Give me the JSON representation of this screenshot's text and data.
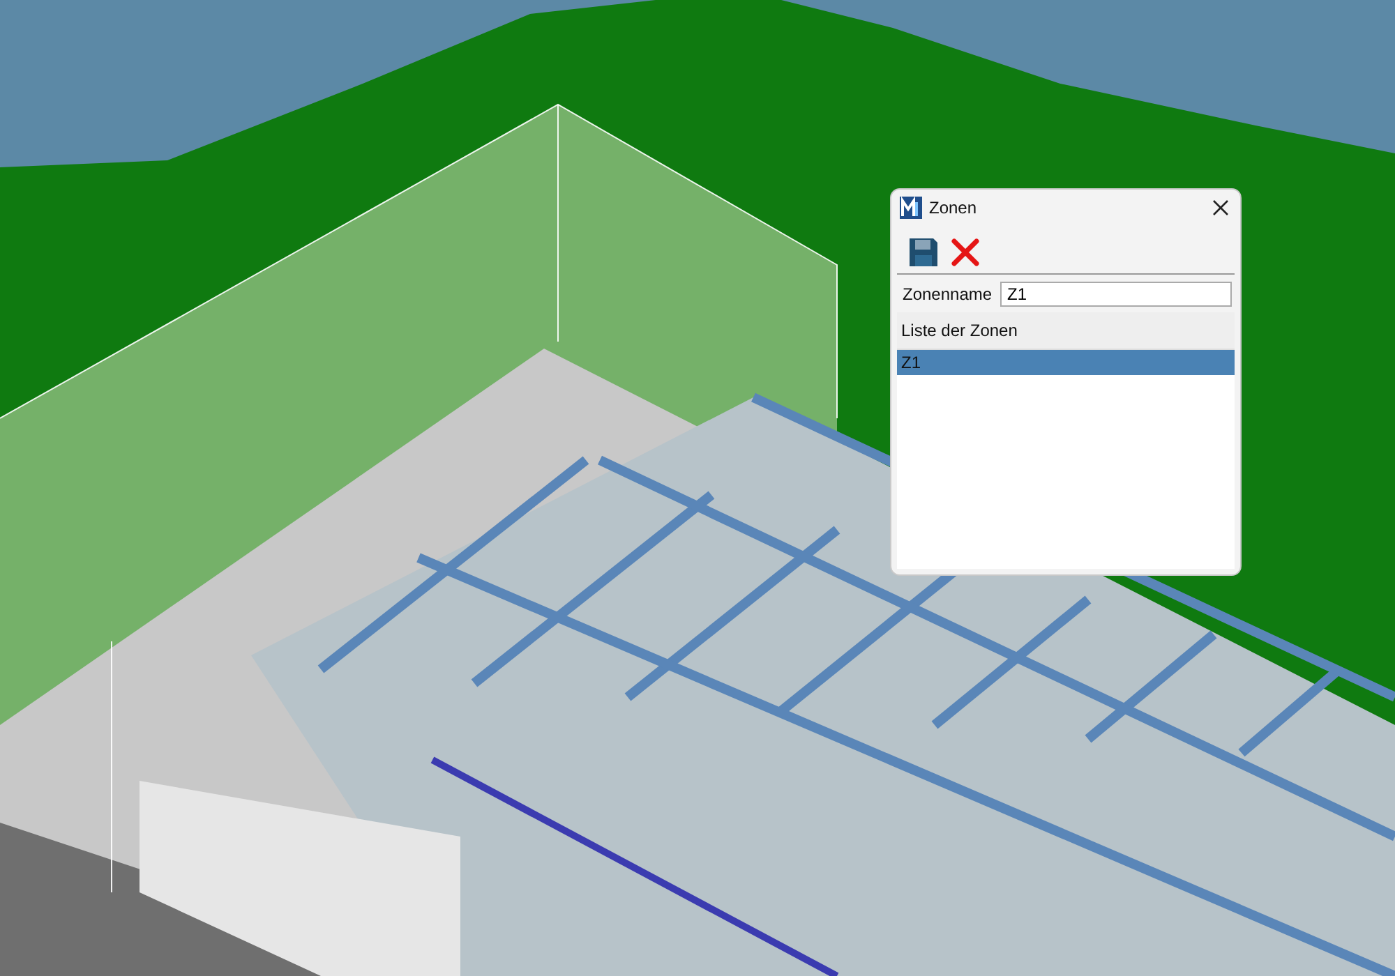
{
  "window": {
    "title": "Zonen"
  },
  "form": {
    "label": "Zonenname",
    "value": "Z1"
  },
  "list": {
    "header": "Liste der Zonen",
    "items": [
      {
        "label": "Z1",
        "selected": true
      }
    ]
  }
}
